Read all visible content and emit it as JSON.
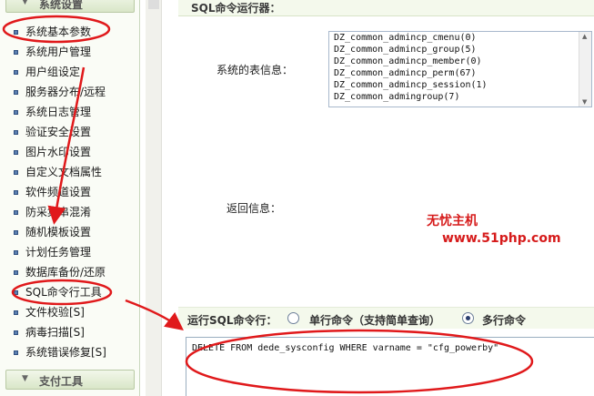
{
  "sidebar": {
    "header_settings": "系统设置",
    "header_pay": "支付工具",
    "items": [
      "系统基本参数",
      "系统用户管理",
      "用户组设定",
      "服务器分布/远程",
      "系统日志管理",
      "验证安全设置",
      "图片水印设置",
      "自定义文档属性",
      "软件频道设置",
      "防采集串混淆",
      "随机模板设置",
      "计划任务管理",
      "数据库备份/还原",
      "SQL命令行工具",
      "文件校验[S]",
      "病毒扫描[S]",
      "系统错误修复[S]"
    ]
  },
  "main": {
    "title": "SQL命令运行器：",
    "table_info_label": "系统的表信息：",
    "return_info_label": "返回信息：",
    "tables": [
      "DZ_common_admincp_cmenu(0)",
      "DZ_common_admincp_group(5)",
      "DZ_common_admincp_member(0)",
      "DZ_common_admincp_perm(67)",
      "DZ_common_admincp_session(1)",
      "DZ_common_admingroup(7)"
    ],
    "run_label": "运行SQL命令行：",
    "option_single": "单行命令（支持简单查询）",
    "option_multi": "多行命令",
    "selected_option": "多行命令",
    "sql_text": "DELETE FROM dede_sysconfig WHERE varname = \"cfg_powerby\""
  },
  "watermark": {
    "line1": "无忧主机",
    "line2": "www.51php.com"
  },
  "colors": {
    "annotation": "#e0191b",
    "accent_header": "#f4f9ec"
  }
}
